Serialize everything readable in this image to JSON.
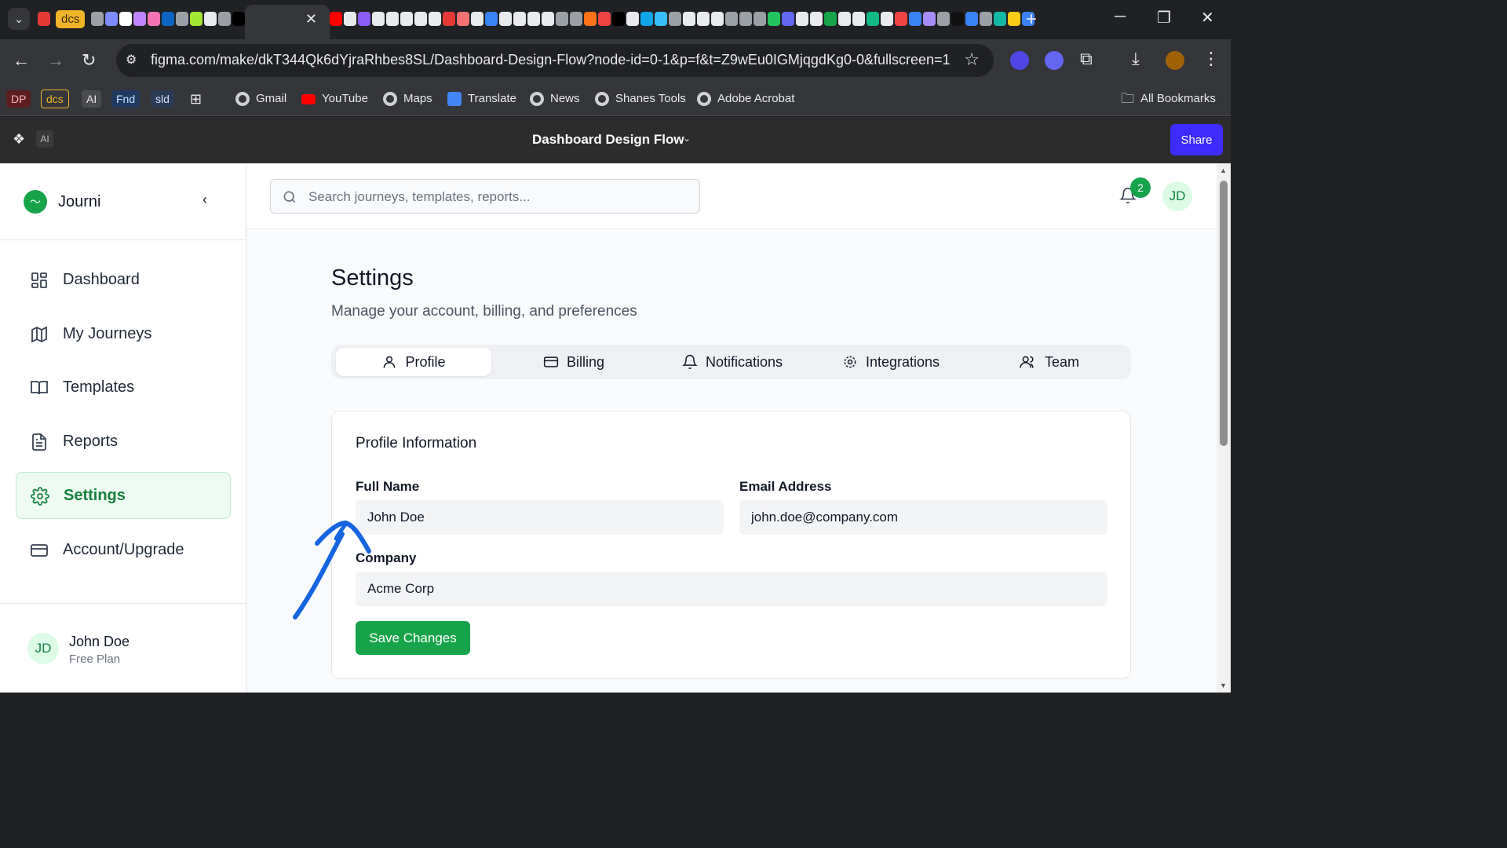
{
  "browser": {
    "tab_group_label": "dcs",
    "url": "figma.com/make/dkT344Qk6dYjraRhbes8SL/Dashboard-Design-Flow?node-id=0-1&p=f&t=Z9wEu0IGMjqgdKg0-0&fullscreen=1",
    "bookmarks": [
      {
        "label": "DP",
        "icon": "dp-chip"
      },
      {
        "label": "dcs",
        "icon": "dcs-chip"
      },
      {
        "label": "AI",
        "icon": "ai-chip"
      },
      {
        "label": "Fnd",
        "icon": "fnd-chip"
      },
      {
        "label": "sld",
        "icon": "sld-chip"
      },
      {
        "label": "Gmail",
        "icon": "globe-icon"
      },
      {
        "label": "YouTube",
        "icon": "youtube-icon"
      },
      {
        "label": "Maps",
        "icon": "globe-icon"
      },
      {
        "label": "Translate",
        "icon": "translate-icon"
      },
      {
        "label": "News",
        "icon": "globe-icon"
      },
      {
        "label": "Shanes Tools",
        "icon": "globe-icon"
      },
      {
        "label": "Adobe Acrobat",
        "icon": "globe-icon"
      }
    ],
    "all_bookmarks_label": "All Bookmarks"
  },
  "figma": {
    "ai_label": "AI",
    "file_title": "Dashboard Design Flow",
    "share_label": "Share",
    "share_color": "#3d2bff"
  },
  "app": {
    "brand_name": "Journi",
    "accent_color": "#16a34a",
    "nav": [
      {
        "label": "Dashboard",
        "icon": "dashboard-icon",
        "active": false
      },
      {
        "label": "My Journeys",
        "icon": "map-icon",
        "active": false
      },
      {
        "label": "Templates",
        "icon": "book-icon",
        "active": false
      },
      {
        "label": "Reports",
        "icon": "document-icon",
        "active": false
      },
      {
        "label": "Settings",
        "icon": "gear-icon",
        "active": true
      },
      {
        "label": "Account/Upgrade",
        "icon": "credit-card-icon",
        "active": false
      }
    ],
    "user": {
      "initials": "JD",
      "name": "John Doe",
      "plan": "Free Plan"
    },
    "search": {
      "placeholder": "Search journeys, templates, reports..."
    },
    "notifications_count": "2",
    "header_avatar_initials": "JD"
  },
  "settings": {
    "title": "Settings",
    "subtitle": "Manage your account, billing, and preferences",
    "tabs": [
      {
        "label": "Profile",
        "icon": "user-icon",
        "active": true
      },
      {
        "label": "Billing",
        "icon": "credit-card-icon",
        "active": false
      },
      {
        "label": "Notifications",
        "icon": "bell-icon",
        "active": false
      },
      {
        "label": "Integrations",
        "icon": "gear-icon",
        "active": false
      },
      {
        "label": "Team",
        "icon": "users-icon",
        "active": false
      }
    ],
    "profile": {
      "section_title": "Profile Information",
      "full_name_label": "Full Name",
      "full_name_value": "John Doe",
      "email_label": "Email Address",
      "email_value": "john.doe@company.com",
      "company_label": "Company",
      "company_value": "Acme Corp",
      "save_label": "Save Changes"
    }
  },
  "annotation": {
    "color": "#1565e0",
    "shape": "hand-drawn-arrow"
  }
}
